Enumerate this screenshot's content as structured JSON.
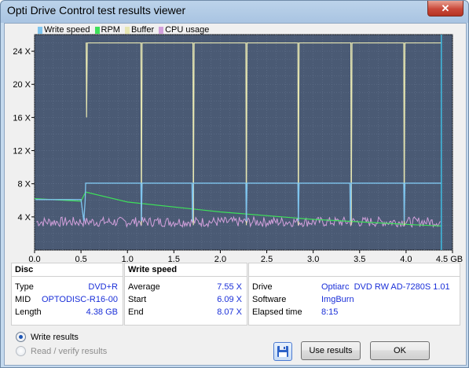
{
  "window": {
    "title": "Opti Drive Control test results viewer",
    "close_label": "✕"
  },
  "legend": [
    {
      "label": "Write speed",
      "color": "#7fc5ef"
    },
    {
      "label": "RPM",
      "color": "#3ee05a"
    },
    {
      "label": "Buffer",
      "color": "#e6e6b2"
    },
    {
      "label": "CPU usage",
      "color": "#d2a0dc"
    }
  ],
  "chart_data": {
    "type": "line",
    "xlabel": "GB",
    "ylabel": "X",
    "xlim": [
      0,
      4.5
    ],
    "ylim": [
      0,
      26
    ],
    "x_ticks": [
      "0.0",
      "0.5",
      "1.0",
      "1.5",
      "2.0",
      "2.5",
      "3.0",
      "3.5",
      "4.0",
      "4.5 GB"
    ],
    "y_ticks": [
      "4 X",
      "8 X",
      "12 X",
      "16 X",
      "20 X",
      "24 X"
    ],
    "grid": true,
    "series": [
      {
        "name": "Write speed",
        "x": [
          0.0,
          0.5,
          0.54,
          0.55,
          4.38
        ],
        "y": [
          6.09,
          6.09,
          6.0,
          8.07,
          8.07
        ]
      },
      {
        "name": "RPM",
        "x": [
          0.0,
          0.5,
          0.55,
          1.0,
          2.0,
          3.0,
          4.0,
          4.38
        ],
        "y": [
          6.2,
          5.9,
          7.0,
          5.8,
          4.6,
          3.7,
          3.1,
          2.9
        ]
      },
      {
        "name": "Buffer",
        "x": [
          0.0,
          0.5,
          1.0,
          1.5,
          2.0,
          2.5,
          3.0,
          3.5,
          4.0,
          4.38
        ],
        "y": [
          25,
          25,
          25,
          25,
          25,
          25,
          25,
          25,
          25,
          25
        ]
      },
      {
        "name": "CPU usage",
        "x": [
          0.0,
          4.38
        ],
        "y": [
          3.4,
          3.4
        ]
      }
    ],
    "write_drops_gb": [
      0.55,
      1.15,
      1.7,
      2.28,
      2.84,
      3.4,
      3.98
    ],
    "buffer_drops_gb": [
      0.56,
      1.15,
      1.71,
      2.28,
      2.84,
      3.41,
      3.98
    ],
    "end_gb": 4.38
  },
  "disc": {
    "title": "Disc",
    "rows": [
      {
        "label": "Type",
        "value": "DVD+R"
      },
      {
        "label": "MID",
        "value": "OPTODISC-R16-00"
      },
      {
        "label": "Length",
        "value": "4.38 GB"
      }
    ]
  },
  "write_speed": {
    "title": "Write speed",
    "rows": [
      {
        "label": "Average",
        "value": "7.55 X"
      },
      {
        "label": "Start",
        "value": "6.09 X"
      },
      {
        "label": "End",
        "value": "8.07 X"
      }
    ]
  },
  "info": {
    "rows": [
      {
        "label": "Drive",
        "value": "Optiarc  DVD RW AD-7280S 1.01"
      },
      {
        "label": "Software",
        "value": "ImgBurn"
      },
      {
        "label": "Elapsed time",
        "value": "8:15"
      }
    ]
  },
  "options": {
    "write_results": "Write results",
    "read_verify_results": "Read / verify results",
    "selected": "write_results"
  },
  "buttons": {
    "use_results": "Use results",
    "ok": "OK"
  },
  "icons": {
    "save": "floppy-disk-icon",
    "close": "close-icon"
  }
}
